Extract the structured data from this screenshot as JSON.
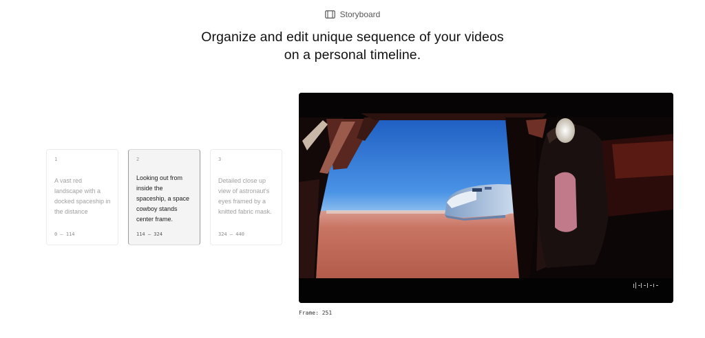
{
  "header": {
    "badge_label": "Storyboard",
    "badge_icon": "film-icon",
    "headline_line1": "Organize and edit unique sequence of your videos",
    "headline_line2": "on a personal timeline."
  },
  "storyboard": {
    "cards": [
      {
        "number": "1",
        "description": "A vast red landscape with a docked spaceship in the distance",
        "range": "0 – 114",
        "active": false
      },
      {
        "number": "2",
        "description": "Looking out from inside the spaceship, a space cowboy stands center frame.",
        "range": "114 – 324",
        "active": true
      },
      {
        "number": "3",
        "description": "Detailed close up view of astronaut's eyes framed by a knitted fabric mask.",
        "range": "324 – 440",
        "active": false
      }
    ]
  },
  "player": {
    "scene": "spaceship-doorway-red-desert",
    "frame_readout": "Frame: 251",
    "watermark_icon": "waveform-icon"
  },
  "colors": {
    "sky": "#2f7bd6",
    "desert": "#c4705f",
    "player_bg": "#030303",
    "active_card_bg": "#f4f4f4"
  }
}
